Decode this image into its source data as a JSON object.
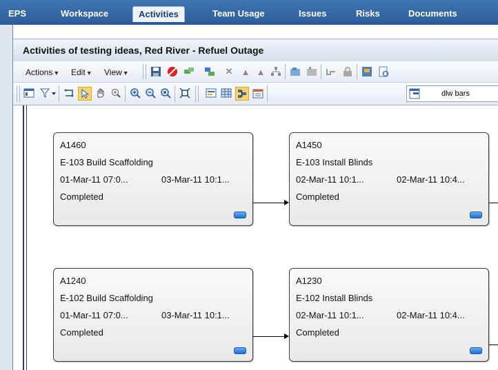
{
  "nav": {
    "tabs": [
      {
        "label": "EPS"
      },
      {
        "label": "Workspace"
      },
      {
        "label": "Activities",
        "active": true
      },
      {
        "label": "Team Usage"
      },
      {
        "label": "Issues"
      },
      {
        "label": "Risks"
      },
      {
        "label": "Documents"
      }
    ]
  },
  "panel": {
    "title": "Activities of testing ideas, Red River - Refuel Outage"
  },
  "toolbar": {
    "menus": [
      "Actions",
      "Edit",
      "View"
    ],
    "layout_select": "dlw bars"
  },
  "icons": {
    "toolbar1": [
      "save-icon",
      "cancel-icon",
      "add-activity-icon",
      "add-predecessor-icon",
      "delete-icon",
      "assign-user-icon",
      "assign-group-icon",
      "org-chart-icon",
      "move-icon",
      "folder-icon",
      "link-icon",
      "lock-icon",
      "export-icon",
      "report-icon"
    ],
    "toolbar2": [
      "layout-icon",
      "filter-icon",
      "swap-icon",
      "pointer-icon",
      "hand-icon",
      "zoom-region-icon",
      "zoom-in-icon",
      "zoom-out-icon",
      "zoom-reset-icon",
      "fit-icon",
      "details-icon",
      "grid-icon",
      "network-icon",
      "calendar-icon",
      "bars-icon"
    ]
  },
  "activities": [
    {
      "id": "A1460",
      "name": "E-103 Build Scaffolding",
      "start": "01-Mar-11 07:0...",
      "finish": "03-Mar-11 10:1...",
      "status": "Completed"
    },
    {
      "id": "A1450",
      "name": "E-103 Install Blinds",
      "start": "02-Mar-11 10:1...",
      "finish": "02-Mar-11 10:4...",
      "status": "Completed"
    },
    {
      "id": "A1240",
      "name": "E-102 Build Scaffolding",
      "start": "01-Mar-11 07:0...",
      "finish": "03-Mar-11 10:1...",
      "status": "Completed"
    },
    {
      "id": "A1230",
      "name": "E-102 Install Blinds",
      "start": "02-Mar-11 10:1...",
      "finish": "02-Mar-11 10:4...",
      "status": "Completed"
    }
  ],
  "colors": {
    "nav_bg": "#2d5c98",
    "status_badge": "#1f6fd1"
  }
}
